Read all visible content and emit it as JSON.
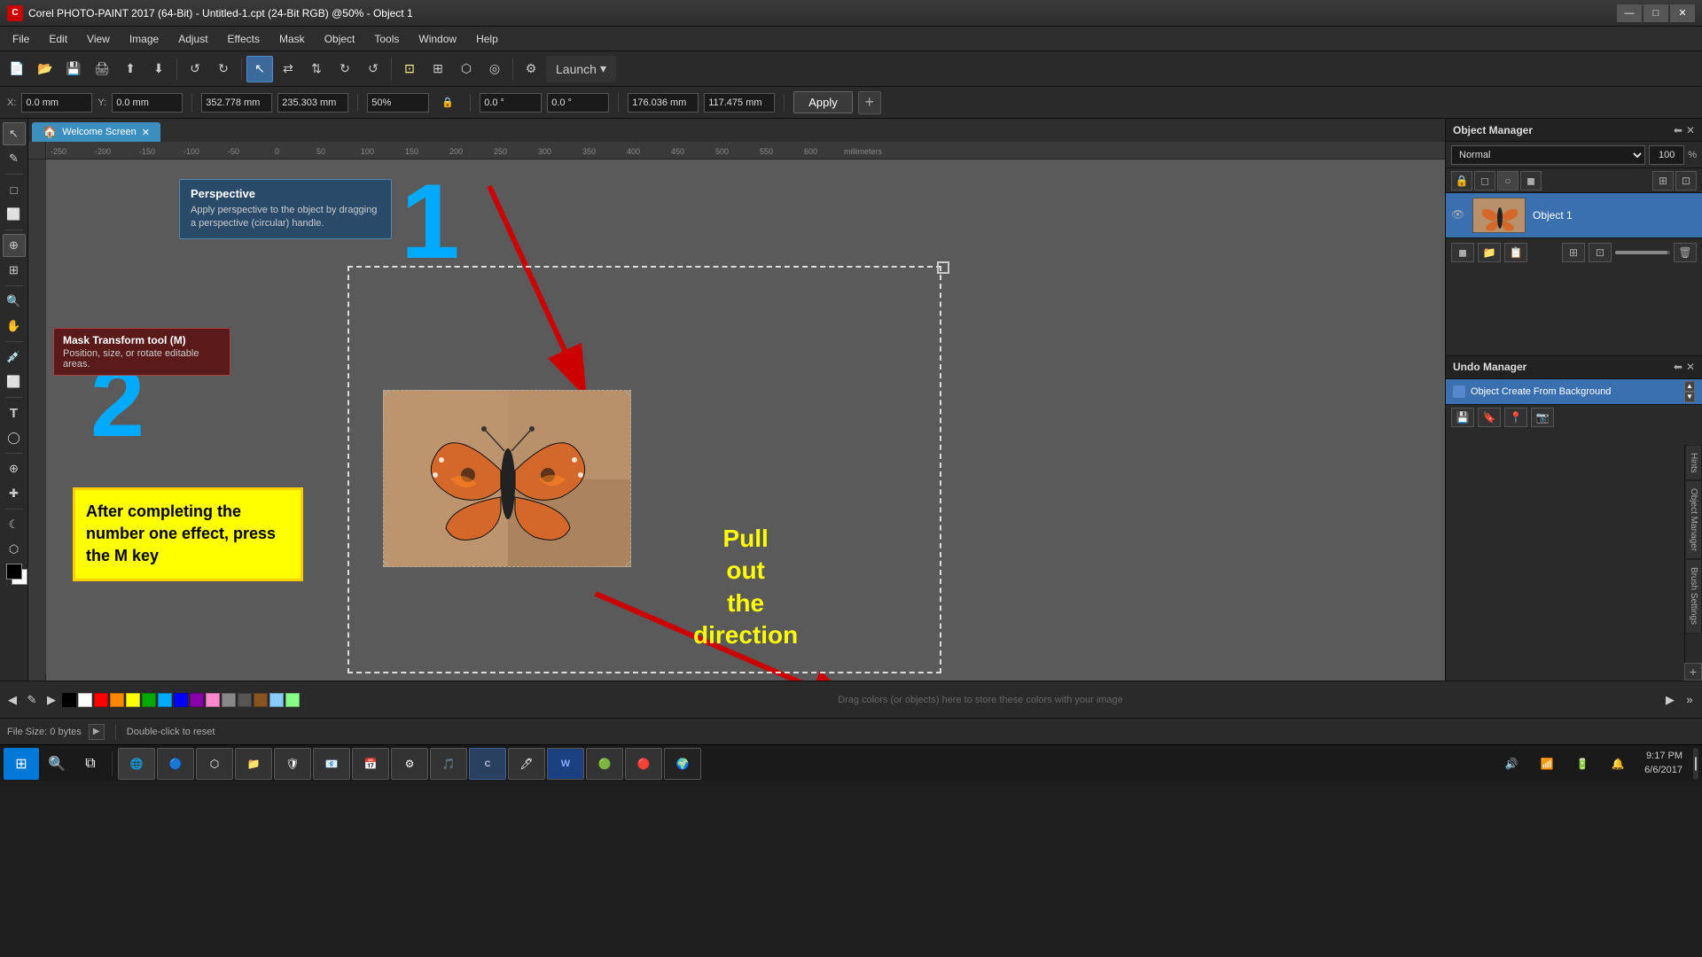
{
  "titlebar": {
    "title": "Corel PHOTO-PAINT 2017 (64-Bit) - Untitled-1.cpt (24-Bit RGB) @50% - Object 1",
    "logo": "C",
    "controls": [
      "—",
      "□",
      "✕"
    ]
  },
  "menubar": {
    "items": [
      "File",
      "Edit",
      "View",
      "Image",
      "Adjust",
      "Effects",
      "Mask",
      "Object",
      "Tools",
      "Window",
      "Help"
    ]
  },
  "transform_toolbar": {
    "x_label": "X:",
    "x_value": "0.0 mm",
    "y_label": "Y:",
    "y_value": "0.0 mm",
    "w_value": "352.778 mm",
    "h_value": "235.303 mm",
    "zoom_value": "50%",
    "angle1": "0.0 °",
    "angle2": "0.0 °",
    "pos1": "176.036 mm",
    "pos2": "117.475 mm",
    "apply_label": "Apply"
  },
  "perspective_tooltip": {
    "title": "Perspective",
    "body": "Apply perspective to the object by dragging a perspective (circular) handle."
  },
  "mask_tooltip": {
    "title": "Mask Transform tool (M)",
    "body": "Position, size, or rotate editable areas."
  },
  "tab": {
    "icon": "🏠",
    "label": "Welcome Screen"
  },
  "canvas_annotation": {
    "num1": "1",
    "num2": "2",
    "yellow_box_text": "After completing the number one effect, press the M key",
    "pull_text": "Pull\nout\nthe\ndirection"
  },
  "object_manager": {
    "title": "Object Manager",
    "blend_mode": "Normal",
    "opacity": "100",
    "pct": "%",
    "object_name": "Object 1",
    "buttons": [
      "🔒",
      "◻",
      "○",
      "◼"
    ],
    "footer_buttons": [
      "◼",
      "◼",
      "◼",
      "🗑"
    ]
  },
  "undo_manager": {
    "title": "Undo Manager",
    "entry": "Object Create From Background"
  },
  "status_bar": {
    "file_size": "File Size: 0 bytes",
    "hint": "Double-click to reset"
  },
  "palette": {
    "drag_hint": "Drag colors (or objects) here to store these colors with your image"
  },
  "taskbar": {
    "time": "9:17 PM",
    "date": "6/6/2017"
  },
  "ruler": {
    "units": "millimeters",
    "ticks": [
      -250,
      -200,
      -150,
      -100,
      -50,
      0,
      50,
      100,
      150,
      200,
      250,
      300,
      350,
      400,
      450,
      500,
      550,
      600
    ]
  }
}
